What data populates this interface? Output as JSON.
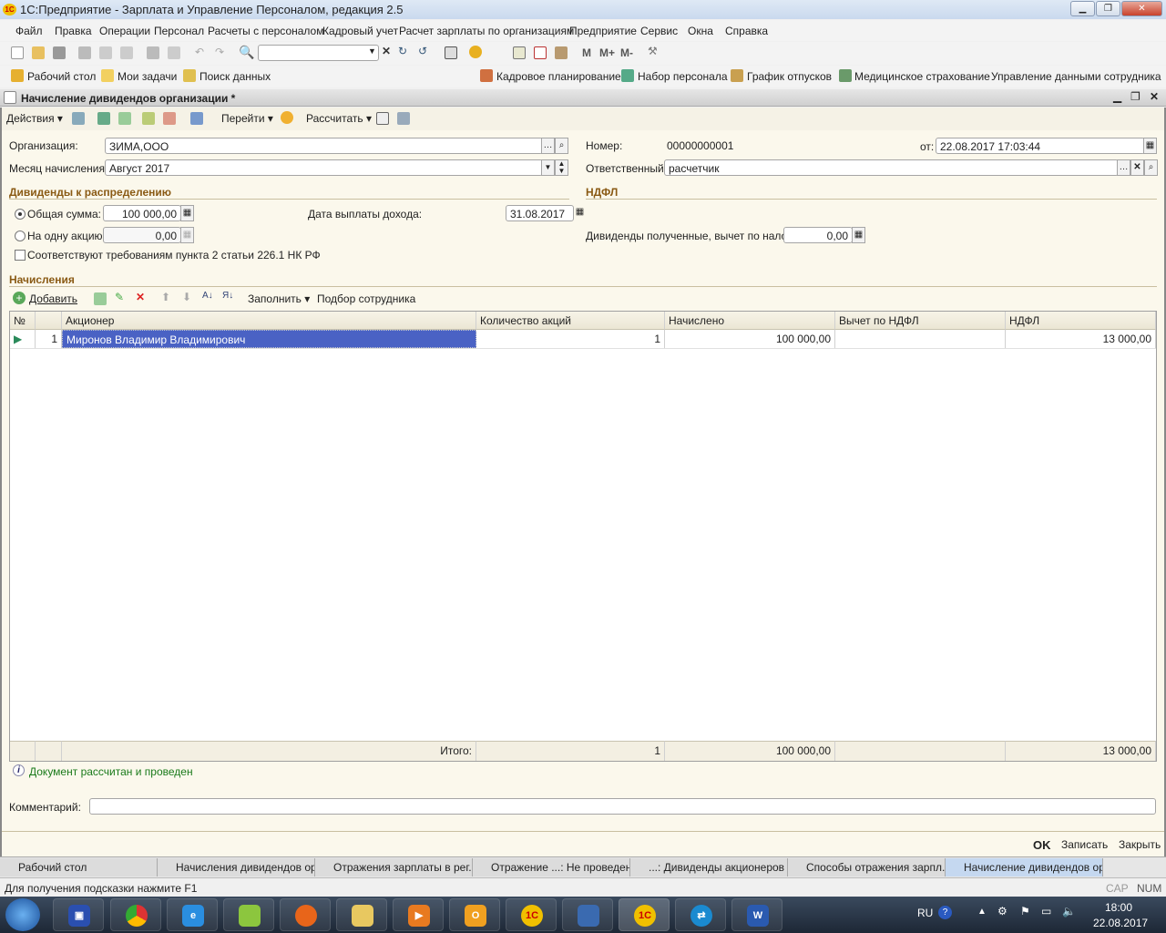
{
  "window": {
    "title": "1С:Предприятие - Зарплата и Управление Персоналом, редакция 2.5",
    "logo_text": "1С"
  },
  "menu": [
    "Файл",
    "Правка",
    "Операции",
    "Персонал",
    "Расчеты с персоналом",
    "Кадровый учет",
    "Расчет зарплаты по организациям",
    "Предприятие",
    "Сервис",
    "Окна",
    "Справка"
  ],
  "toolbar1": {
    "search_value": "",
    "buttons": [
      "M",
      "M+",
      "M-"
    ]
  },
  "toolbar2": {
    "left": [
      "Рабочий стол",
      "Мои задачи",
      "Поиск данных"
    ],
    "right": [
      "Кадровое планирование",
      "Набор персонала",
      "График отпусков",
      "Медицинское страхование",
      "Управление данными сотрудника"
    ]
  },
  "document": {
    "title": "Начисление дивидендов организации *",
    "toolbar": {
      "actions": "Действия",
      "goto": "Перейти",
      "calculate": "Рассчитать"
    },
    "org_label": "Организация:",
    "org_value": "ЗИМА,ООО",
    "month_label": "Месяц начисления:",
    "month_value": "Август 2017",
    "number_label": "Номер:",
    "number_value": "00000000001",
    "date_label": "от:",
    "date_value": "22.08.2017 17:03:44",
    "responsible_label": "Ответственный:",
    "responsible_value": "расчетчик",
    "section_dividends": "Дивиденды к распределению",
    "section_ndfl": "НДФЛ",
    "total_label": "Общая сумма:",
    "total_value": "100 000,00",
    "total_selected": true,
    "per_share_label": "На одну акцию:",
    "per_share_value": "0,00",
    "payment_date_label": "Дата выплаты дохода:",
    "payment_date_value": "31.08.2017",
    "received_label": "Дивиденды полученные, вычет по налогу:",
    "received_value": "0,00",
    "compliance_label": "Соответствуют требованиям пункта 2 статьи 226.1 НК РФ",
    "compliance_checked": false,
    "section_accruals": "Начисления",
    "table_toolbar": {
      "add": "Добавить",
      "fill": "Заполнить",
      "pick": "Подбор сотрудника"
    },
    "table": {
      "columns": [
        "№",
        "",
        "Акционер",
        "Количество акций",
        "Начислено",
        "Вычет по НДФЛ",
        "НДФЛ"
      ],
      "rows": [
        {
          "n": "1",
          "holder": "Миронов Владимир Владимирович",
          "shares": "1",
          "accrued": "100 000,00",
          "deduction": "",
          "ndfl": "13 000,00"
        }
      ],
      "footer": {
        "label": "Итого:",
        "shares": "1",
        "accrued": "100 000,00",
        "ndfl": "13 000,00"
      }
    },
    "info": "Документ рассчитан и проведен",
    "comment_label": "Комментарий:",
    "comment_value": "",
    "buttons": {
      "ok": "OK",
      "save": "Записать",
      "close": "Закрыть"
    }
  },
  "window_tabs": [
    "Рабочий стол",
    "Начисления дивидендов ор...",
    "Отражения зарплаты в рег...",
    "Отражение ...: Не проведен *",
    "...: Дивиденды акционеров *",
    "Способы отражения зарпл...",
    "Начисление дивидендов ор..."
  ],
  "status": {
    "hint": "Для получения подсказки нажмите F1",
    "cap": "CAP",
    "num": "NUM"
  },
  "taskbar": {
    "lang": "RU",
    "time": "18:00",
    "date": "22.08.2017"
  },
  "colors": {
    "selection": "#4a62c4",
    "section": "#8a5a14",
    "info": "#1a7a1a"
  }
}
